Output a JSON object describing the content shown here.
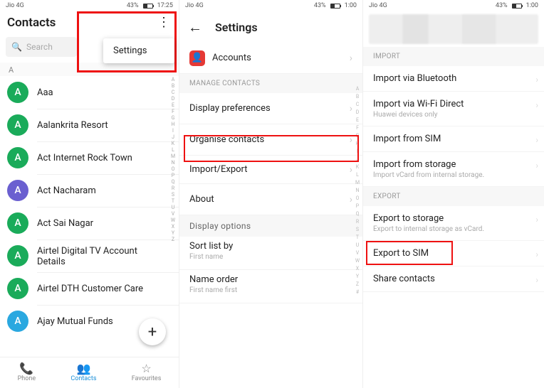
{
  "statusbar": {
    "carrier": "Jio 4G",
    "signals": "📶 📶",
    "battery_pct": "43%",
    "time": "1:00"
  },
  "pane1": {
    "title": "Contacts",
    "search_placeholder": "Search",
    "popup_item": "Settings",
    "section": "A",
    "contacts": [
      {
        "initial": "A",
        "color": "#1aab5a",
        "name": "Aaa"
      },
      {
        "initial": "A",
        "color": "#1aab5a",
        "name": "Aalankrita Resort"
      },
      {
        "initial": "A",
        "color": "#1aab5a",
        "name": "Act Internet Rock Town"
      },
      {
        "initial": "A",
        "color": "#6a5fd0",
        "name": "Act Nacharam"
      },
      {
        "initial": "A",
        "color": "#1aab5a",
        "name": "Act Sai Nagar"
      },
      {
        "initial": "A",
        "color": "#1aab5a",
        "name": "Airtel Digital TV Account Details"
      },
      {
        "initial": "A",
        "color": "#1aab5a",
        "name": "Airtel DTH Customer Care"
      },
      {
        "initial": "A",
        "color": "#2aa8e0",
        "name": "Ajay Mutual Funds"
      }
    ],
    "fab_label": "+",
    "bottom": {
      "phone": "Phone",
      "contacts": "Contacts",
      "favourites": "Favourites"
    },
    "azindex": "A\nB\nC\nD\nE\nF\nG\nH\nI\nJ\nK\nL\nM\nN\nO\nP\nQ\nR\nS\nT\nU\nV\nW\nX\nY\nZ"
  },
  "pane2": {
    "title": "Settings",
    "accounts": "Accounts",
    "manage_header": "MANAGE CONTACTS",
    "rows": {
      "display_pref": "Display preferences",
      "organise": "Organise contacts",
      "import_export": "Import/Export",
      "about": "About"
    },
    "display_opts_header": "Display options",
    "sort": {
      "label": "Sort list by",
      "value": "First name"
    },
    "nameorder": {
      "label": "Name order",
      "value": "First name first"
    },
    "azindex": "A\nB\nC\nD\nE\nF\nG\nH\nI\nJ\nK\nL\nM\nN\nO\nP\nQ\nR\nS\nT\nU\nV\nW\nX\nY\nZ\n#"
  },
  "pane3": {
    "import_header": "IMPORT",
    "import_bt": "Import via Bluetooth",
    "import_wifi": {
      "label": "Import via Wi-Fi Direct",
      "sub": "Huawei devices only"
    },
    "import_sim": "Import from SIM",
    "import_storage": {
      "label": "Import from storage",
      "sub": "Import vCard from internal storage."
    },
    "export_header": "EXPORT",
    "export_storage": {
      "label": "Export to storage",
      "sub": "Export to internal storage as vCard."
    },
    "export_sim": "Export to SIM",
    "share": "Share contacts"
  }
}
